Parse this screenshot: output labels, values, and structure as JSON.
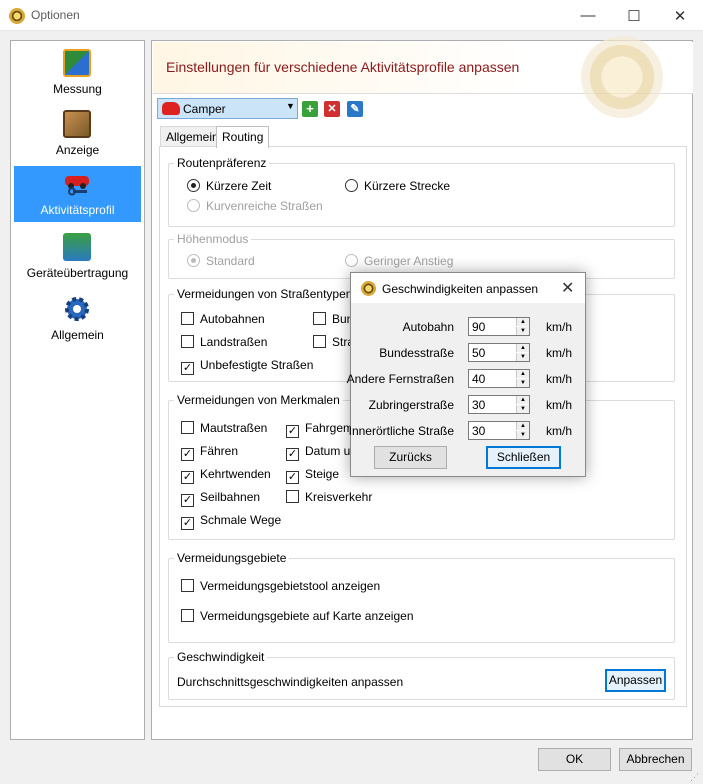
{
  "window": {
    "title": "Optionen",
    "min_glyph": "—",
    "max_glyph": "☐",
    "close_glyph": "✕"
  },
  "sidebar": {
    "items": [
      {
        "label": "Messung",
        "icon": "ruler-icon",
        "selected": false
      },
      {
        "label": "Anzeige",
        "icon": "map-display-icon",
        "selected": false
      },
      {
        "label": "Aktivitätsprofil",
        "icon": "car-profile-icon",
        "selected": true
      },
      {
        "label": "Geräteübertragung",
        "icon": "device-transfer-icon",
        "selected": false
      },
      {
        "label": "Allgemein",
        "icon": "gear-icon",
        "selected": false
      }
    ]
  },
  "header": {
    "title": "Einstellungen für verschiedene Aktivitätsprofile anpassen"
  },
  "profile": {
    "selected": "Camper",
    "arrow": "▼",
    "add_glyph": "+",
    "delete_glyph": "✕",
    "edit_glyph": "✎"
  },
  "tabs": [
    {
      "label": "Allgemein",
      "active": false
    },
    {
      "label": "Routing",
      "active": true
    }
  ],
  "routing": {
    "routenpraeferenz": {
      "title": "Routenpräferenz",
      "options": [
        {
          "label": "Kürzere Zeit",
          "checked": true,
          "enabled": true
        },
        {
          "label": "Kürzere Strecke",
          "checked": false,
          "enabled": true
        },
        {
          "label": "Kurvenreiche Straßen",
          "checked": false,
          "enabled": false
        }
      ]
    },
    "hoehenmodus": {
      "title": "Höhenmodus",
      "options": [
        {
          "label": "Standard",
          "checked": true,
          "enabled": false
        },
        {
          "label": "Geringer Anstieg",
          "checked": false,
          "enabled": false
        }
      ]
    },
    "strassentypen": {
      "title": "Vermeidungen von Straßentypen",
      "items": [
        {
          "label": "Autobahnen",
          "checked": false
        },
        {
          "label": "Bun",
          "checked": false
        },
        {
          "label": "Landstraßen",
          "checked": false
        },
        {
          "label": "Stra",
          "checked": false
        },
        {
          "label": "Unbefestigte Straßen",
          "checked": true
        }
      ]
    },
    "merkmale": {
      "title": "Vermeidungen von Merkmalen",
      "items": [
        {
          "label": "Mautstraßen",
          "checked": false
        },
        {
          "label": "Fahrgeme",
          "checked": true
        },
        {
          "label": "Fähren",
          "checked": true
        },
        {
          "label": "Datum und",
          "checked": true
        },
        {
          "label": "Kehrtwenden",
          "checked": true
        },
        {
          "label": "Steige",
          "checked": true
        },
        {
          "label": "Seilbahnen",
          "checked": true
        },
        {
          "label": "Kreisverkehr",
          "checked": false
        },
        {
          "label": "Schmale Wege",
          "checked": true
        }
      ]
    },
    "gebiete": {
      "title": "Vermeidungsgebiete",
      "items": [
        {
          "label": "Vermeidungsgebietstool anzeigen",
          "checked": false
        },
        {
          "label": "Vermeidungsgebiete auf Karte anzeigen",
          "checked": false
        }
      ]
    },
    "geschwindigkeit": {
      "title": "Geschwindigkeit",
      "label": "Durchschnittsgeschwindigkeiten anpassen",
      "button": "Anpassen"
    }
  },
  "footer": {
    "ok": "OK",
    "cancel": "Abbrechen"
  },
  "dialog": {
    "title": "Geschwindigkeiten anpassen",
    "close_glyph": "✕",
    "rows": [
      {
        "label": "Autobahn",
        "value": "90",
        "unit": "km/h"
      },
      {
        "label": "Bundesstraße",
        "value": "50",
        "unit": "km/h"
      },
      {
        "label": "Andere Fernstraßen",
        "value": "40",
        "unit": "km/h"
      },
      {
        "label": "Zubringerstraße",
        "value": "30",
        "unit": "km/h"
      },
      {
        "label": "Innerörtliche Straße",
        "value": "30",
        "unit": "km/h"
      }
    ],
    "reset_button": "Zurücks",
    "close_button": "Schließen"
  },
  "colors": {
    "selection": "#3399ff",
    "header_title": "#8b1a1a",
    "default_button_border": "#0078d7"
  }
}
